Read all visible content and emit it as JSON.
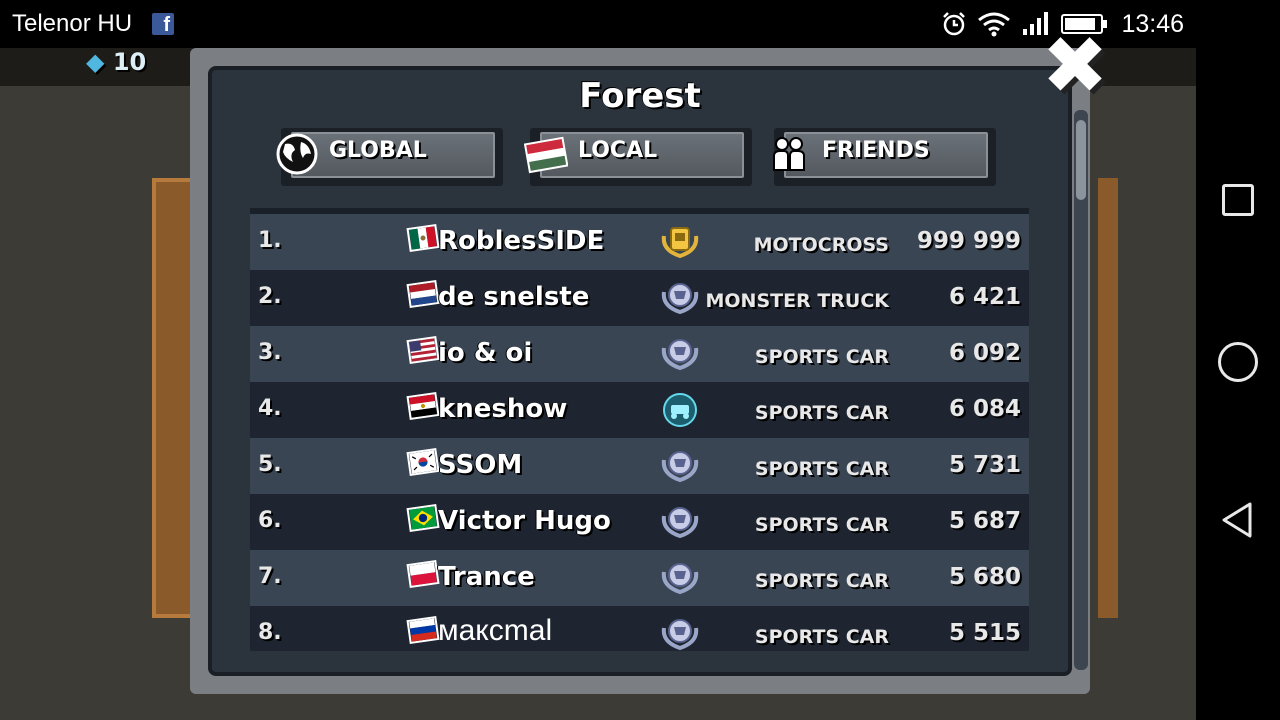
{
  "status_bar": {
    "carrier": "Telenor HU",
    "time": "13:46"
  },
  "background": {
    "gems": "10"
  },
  "leaderboard": {
    "title": "Forest",
    "tabs": [
      {
        "label": "GLOBAL",
        "icon": "globe-icon"
      },
      {
        "label": "LOCAL",
        "icon": "hungary-flag-icon"
      },
      {
        "label": "FRIENDS",
        "icon": "friends-icon"
      }
    ],
    "rows": [
      {
        "rank": "1.",
        "flag": "mexico",
        "name": "RoblesSIDE",
        "badge": "gold",
        "vehicle": "MOTOCROSS",
        "score": "999 999"
      },
      {
        "rank": "2.",
        "flag": "netherlands",
        "name": "de snelste",
        "badge": "silver",
        "vehicle": "MONSTER TRUCK",
        "score": "6 421"
      },
      {
        "rank": "3.",
        "flag": "usa",
        "name": "io & oi",
        "badge": "silver",
        "vehicle": "SPORTS CAR",
        "score": "6 092"
      },
      {
        "rank": "4.",
        "flag": "egypt",
        "name": "kneshow",
        "badge": "diamond",
        "vehicle": "SPORTS CAR",
        "score": "6 084"
      },
      {
        "rank": "5.",
        "flag": "south-korea",
        "name": "SSOM",
        "badge": "silver",
        "vehicle": "SPORTS CAR",
        "score": "5 731"
      },
      {
        "rank": "6.",
        "flag": "brazil",
        "name": "Victor Hugo",
        "badge": "silver",
        "vehicle": "SPORTS CAR",
        "score": "5 687"
      },
      {
        "rank": "7.",
        "flag": "poland",
        "name": "Trance",
        "badge": "silver",
        "vehicle": "SPORTS CAR",
        "score": "5 680"
      },
      {
        "rank": "8.",
        "flag": "russia",
        "name": "максmal",
        "badge": "silver",
        "vehicle": "SPORTS CAR",
        "score": "5 515"
      }
    ]
  }
}
